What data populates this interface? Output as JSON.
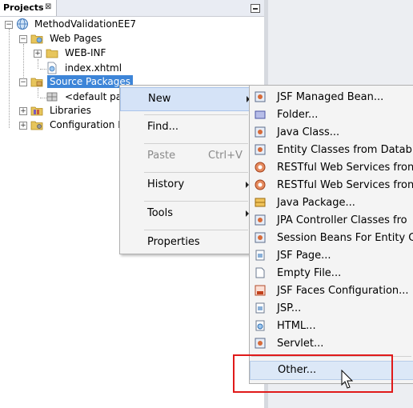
{
  "panel": {
    "tab_label": "Projects",
    "tab_close": "⊠"
  },
  "tree": {
    "project": "MethodValidationEE7",
    "web_pages": "Web Pages",
    "web_inf": "WEB-INF",
    "index": "index.xhtml",
    "source_packages": "Source Packages",
    "default_package": "<default pa",
    "libraries": "Libraries",
    "configuration": "Configuration F"
  },
  "context_menu": {
    "new": "New",
    "find": "Find...",
    "paste": "Paste",
    "paste_shortcut": "Ctrl+V",
    "history": "History",
    "tools": "Tools",
    "properties": "Properties"
  },
  "submenu": {
    "items": [
      {
        "label": "JSF Managed Bean...",
        "icon": "managed-bean-icon"
      },
      {
        "label": "Folder...",
        "icon": "folder-icon"
      },
      {
        "label": "Java Class...",
        "icon": "java-class-icon"
      },
      {
        "label": "Entity Classes from Datab",
        "icon": "entity-class-icon"
      },
      {
        "label": "RESTful Web Services fron",
        "icon": "rest-service-icon"
      },
      {
        "label": "RESTful Web Services fron",
        "icon": "rest-service-icon"
      },
      {
        "label": "Java Package...",
        "icon": "package-icon"
      },
      {
        "label": "JPA Controller Classes fro",
        "icon": "jpa-controller-icon"
      },
      {
        "label": "Session Beans For Entity C",
        "icon": "session-bean-icon"
      },
      {
        "label": "JSF Page...",
        "icon": "jsf-page-icon"
      },
      {
        "label": "Empty File...",
        "icon": "empty-file-icon"
      },
      {
        "label": "JSF Faces Configuration...",
        "icon": "faces-config-icon"
      },
      {
        "label": "JSP...",
        "icon": "jsp-icon"
      },
      {
        "label": "HTML...",
        "icon": "html-icon"
      },
      {
        "label": "Servlet...",
        "icon": "servlet-icon"
      }
    ],
    "other": "Other..."
  }
}
